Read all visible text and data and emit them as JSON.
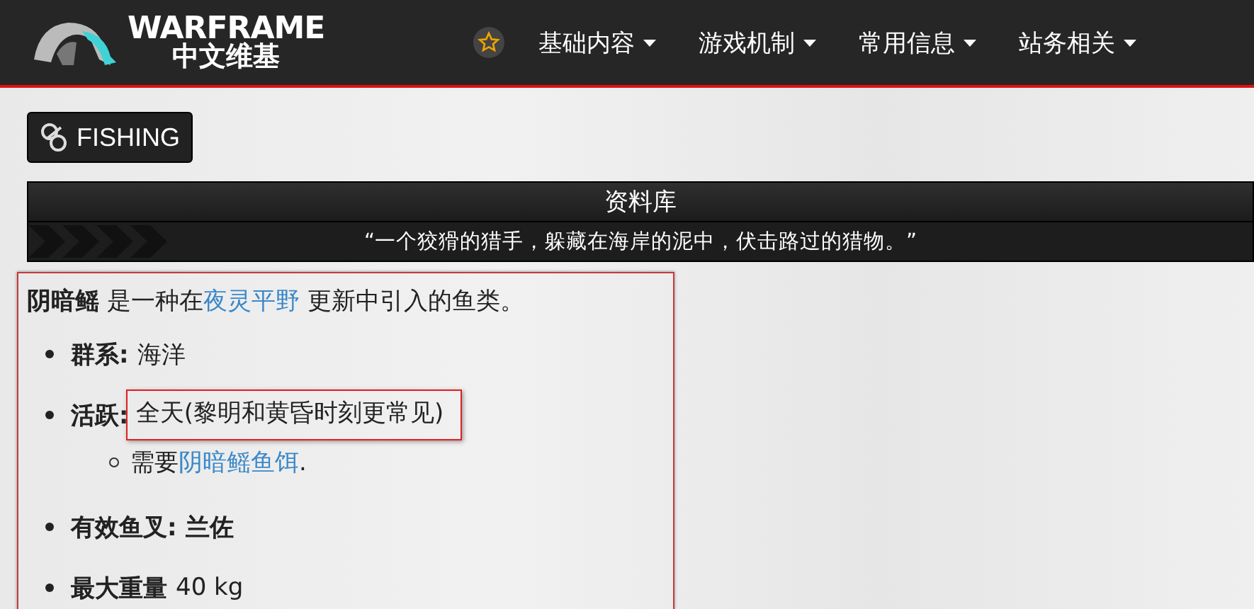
{
  "header": {
    "logo_title": "WARFRAME",
    "logo_subtitle": "中文维基",
    "nav": [
      {
        "label": "基础内容"
      },
      {
        "label": "游戏机制"
      },
      {
        "label": "常用信息"
      },
      {
        "label": "站务相关"
      }
    ]
  },
  "category_button": {
    "label": "FISHING"
  },
  "banner": {
    "title": "资料库",
    "quote": "“一个狡猾的猎手，躲藏在海岸的泥中，伏击路过的猎物。”"
  },
  "intro": {
    "name": "阴暗鳐",
    "before_link": " 是一种在",
    "link": "夜灵平野",
    "after_link": " 更新中引入的鱼类。"
  },
  "facts": [
    {
      "label": "群系:",
      "value": "海洋",
      "value_bold": false,
      "highlighted": false
    },
    {
      "label": "活跃:",
      "value": "全天(黎明和黄昏时刻更常见)",
      "value_bold": false,
      "highlighted": true,
      "children": [
        {
          "before_link": "需要",
          "link": "阴暗鳐鱼饵",
          "after_link": "."
        }
      ]
    },
    {
      "label": "有效鱼叉:",
      "value": "兰佐",
      "value_bold": true,
      "highlighted": false
    },
    {
      "label": "最大重量",
      "value": "40 kg",
      "value_bold": false,
      "highlighted": false
    }
  ]
}
